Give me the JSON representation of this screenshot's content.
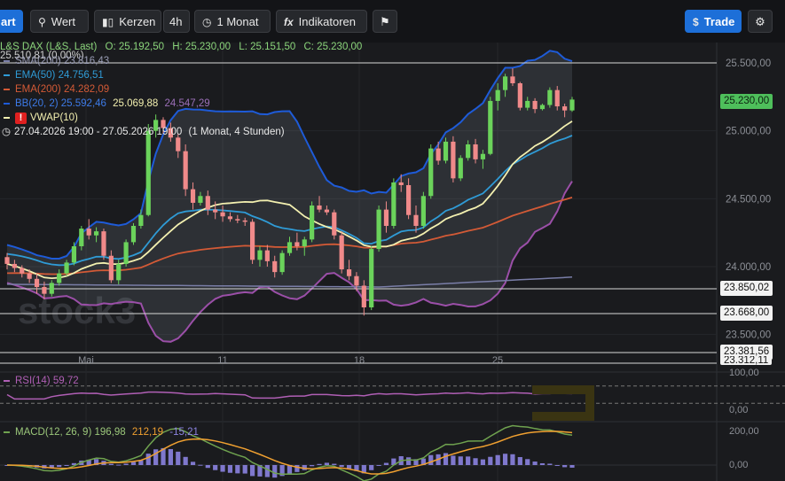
{
  "toolbar": {
    "chart_label": "art",
    "value_label": "Wert",
    "candles_label": "Kerzen",
    "interval_label": "4h",
    "range_label": "1 Monat",
    "indicators_label": "Indikatoren",
    "trade_label": "Trade"
  },
  "legend": {
    "instrument": "L&S DAX (L&S, Last)",
    "o_label": "O:",
    "o_value": "25.192,50",
    "h_label": "H:",
    "h_value": "25.230,00",
    "l_label": "L:",
    "l_value": "25.151,50",
    "c_label": "C:",
    "c_value": "25.230,00",
    "change": "25.510,81 (0,00%)",
    "sma_label": "SMA(200)",
    "sma_value": "23.816,43",
    "ema50_label": "EMA(50)",
    "ema50_value": "24.756,51",
    "ema200_label": "EMA(200)",
    "ema200_value": "24.282,09",
    "bb_label": "BB(20, 2)",
    "bb_upper": "25.592,46",
    "bb_mid": "25.069,88",
    "bb_lower": "24.547,29",
    "vwap_label": "VWAP(10)",
    "period": "27.04.2026 19:00 - 27.05.2026 19:00",
    "period_note": "(1 Monat, 4 Stunden)"
  },
  "watermark": "stock3",
  "price_axis": {
    "ticks": [
      "25.500,00",
      "25.000,00",
      "24.500,00",
      "24.000,00",
      "23.500,00"
    ],
    "current_label": "25.230,00",
    "levels": [
      "23.850,02",
      "23.668,00",
      "23.381,56",
      "23.312,11"
    ]
  },
  "time_axis": [
    "Mai",
    "11",
    "18",
    "25"
  ],
  "rsi": {
    "label": "RSI(14)",
    "value": "59,72",
    "ticks": [
      "100,00",
      "0,00"
    ]
  },
  "macd": {
    "label": "MACD(12, 26, 9)",
    "macd_value": "196,98",
    "signal_value": "212,19",
    "hist_value": "-15,21",
    "ticks": [
      "200,00",
      "0,00"
    ]
  },
  "colors": {
    "up": "#6bd35b",
    "down": "#f08a8a",
    "bb": "#1e5bd8",
    "ema50": "#2f9bd6",
    "ema200": "#d35a36",
    "sma": "#7a7ea8",
    "vwap": "#f3f0b0",
    "trade": "#1d6fd8"
  },
  "chart_data": {
    "type": "candlestick",
    "ylim": [
      23350,
      25600
    ],
    "candles": [
      [
        24070,
        24100,
        23980,
        24020
      ],
      [
        24020,
        24050,
        23960,
        23990
      ],
      [
        23990,
        24010,
        23920,
        23950
      ],
      [
        23950,
        23980,
        23880,
        23910
      ],
      [
        23910,
        23950,
        23800,
        23850
      ],
      [
        23850,
        23890,
        23760,
        23800
      ],
      [
        23800,
        23900,
        23780,
        23880
      ],
      [
        23880,
        23980,
        23860,
        23950
      ],
      [
        23950,
        24050,
        23930,
        24030
      ],
      [
        24030,
        24180,
        24010,
        24150
      ],
      [
        24150,
        24300,
        24120,
        24280
      ],
      [
        24280,
        24350,
        24200,
        24230
      ],
      [
        24230,
        24290,
        24180,
        24260
      ],
      [
        24260,
        24280,
        24050,
        24080
      ],
      [
        24080,
        24120,
        23880,
        23900
      ],
      [
        23900,
        24050,
        23870,
        24020
      ],
      [
        24020,
        24200,
        24000,
        24180
      ],
      [
        24180,
        24320,
        24160,
        24300
      ],
      [
        24300,
        24420,
        24280,
        24380
      ],
      [
        24380,
        25050,
        24370,
        25000
      ],
      [
        25000,
        25120,
        24950,
        25080
      ],
      [
        25080,
        25100,
        24980,
        25020
      ],
      [
        25020,
        25060,
        24920,
        24950
      ],
      [
        24950,
        24980,
        24800,
        24850
      ],
      [
        24850,
        24900,
        24520,
        24570
      ],
      [
        24570,
        24620,
        24420,
        24470
      ],
      [
        24470,
        24550,
        24450,
        24520
      ],
      [
        24520,
        24560,
        24380,
        24420
      ],
      [
        24420,
        24480,
        24350,
        24400
      ],
      [
        24400,
        24450,
        24330,
        24370
      ],
      [
        24370,
        24400,
        24330,
        24350
      ],
      [
        24350,
        24380,
        24320,
        24340
      ],
      [
        24340,
        24360,
        24300,
        24330
      ],
      [
        24330,
        24350,
        24020,
        24050
      ],
      [
        24050,
        24150,
        24000,
        24120
      ],
      [
        24120,
        24160,
        24000,
        24040
      ],
      [
        24040,
        24080,
        23920,
        23960
      ],
      [
        23960,
        24120,
        23940,
        24100
      ],
      [
        24100,
        24220,
        24080,
        24180
      ],
      [
        24180,
        24250,
        24120,
        24150
      ],
      [
        24150,
        24220,
        24080,
        24200
      ],
      [
        24200,
        24480,
        24180,
        24450
      ],
      [
        24450,
        24520,
        24400,
        24420
      ],
      [
        24420,
        24450,
        24380,
        24400
      ],
      [
        24400,
        24420,
        24200,
        24230
      ],
      [
        24230,
        24260,
        23950,
        23980
      ],
      [
        23980,
        24050,
        23900,
        23930
      ],
      [
        23930,
        23960,
        23820,
        23860
      ],
      [
        23860,
        23900,
        23640,
        23700
      ],
      [
        23700,
        24150,
        23680,
        24130
      ],
      [
        24130,
        24450,
        24110,
        24420
      ],
      [
        24420,
        24480,
        24250,
        24300
      ],
      [
        24300,
        24650,
        24280,
        24620
      ],
      [
        24620,
        24680,
        24550,
        24600
      ],
      [
        24600,
        24650,
        24350,
        24380
      ],
      [
        24380,
        24450,
        24250,
        24300
      ],
      [
        24300,
        24550,
        24280,
        24520
      ],
      [
        24520,
        24900,
        24500,
        24870
      ],
      [
        24870,
        24920,
        24750,
        24780
      ],
      [
        24780,
        24950,
        24760,
        24920
      ],
      [
        24920,
        24960,
        24620,
        24650
      ],
      [
        24650,
        24820,
        24630,
        24800
      ],
      [
        24800,
        24930,
        24780,
        24900
      ],
      [
        24900,
        24940,
        24760,
        24790
      ],
      [
        24790,
        24860,
        24720,
        24830
      ],
      [
        24830,
        25250,
        24820,
        25220
      ],
      [
        25220,
        25350,
        25150,
        25300
      ],
      [
        25300,
        25420,
        25250,
        25400
      ],
      [
        25400,
        25460,
        25330,
        25350
      ],
      [
        25350,
        25360,
        25150,
        25170
      ],
      [
        25170,
        25250,
        25150,
        25220
      ],
      [
        25220,
        25240,
        25130,
        25160
      ],
      [
        25160,
        25200,
        25150,
        25190
      ],
      [
        25190,
        25320,
        25170,
        25300
      ],
      [
        25300,
        25330,
        25150,
        25180
      ],
      [
        25180,
        25200,
        25100,
        25150
      ],
      [
        25150,
        25250,
        25140,
        25230
      ]
    ]
  }
}
